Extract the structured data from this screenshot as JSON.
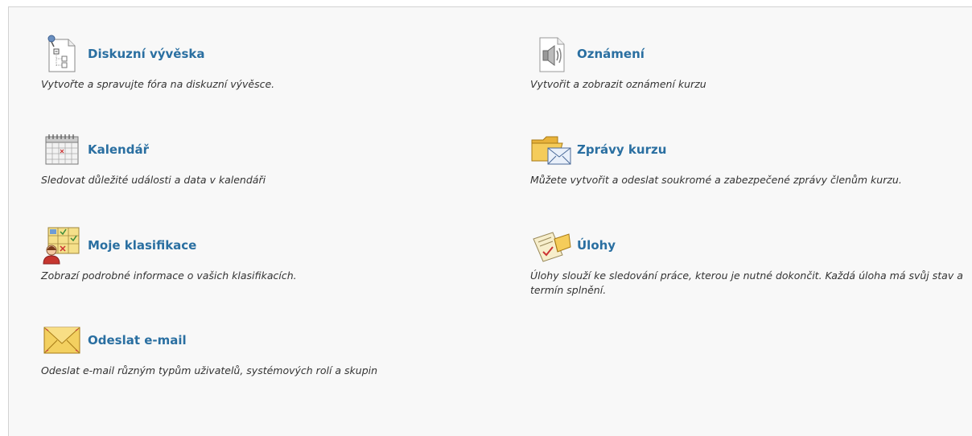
{
  "tools": [
    {
      "title": "Diskuzní vývěska",
      "description": "Vytvořte a spravujte fóra na diskuzní vývěsce.",
      "icon": "discussion-board-icon"
    },
    {
      "title": "Oznámení",
      "description": "Vytvořit a zobrazit oznámení kurzu",
      "icon": "speaker-icon"
    },
    {
      "title": "Kalendář",
      "description": "Sledovat důležité události a data v kalendáři",
      "icon": "calendar-icon"
    },
    {
      "title": "Zprávy kurzu",
      "description": "Můžete vytvořit a odeslat soukromé a zabezpečené zprávy členům kurzu.",
      "icon": "folder-mail-icon"
    },
    {
      "title": "Moje klasifikace",
      "description": "Zobrazí podrobné informace o vašich klasifikacích.",
      "icon": "grades-icon"
    },
    {
      "title": "Úlohy",
      "description": "Úlohy slouží ke sledování práce, kterou je nutné dokončit. Každá úloha má svůj stav a termín splnění.",
      "icon": "tasks-icon"
    },
    {
      "title": "Odeslat e-mail",
      "description": "Odeslat e-mail různým typům uživatelů, systémových rolí a skupin",
      "icon": "envelope-icon"
    }
  ]
}
